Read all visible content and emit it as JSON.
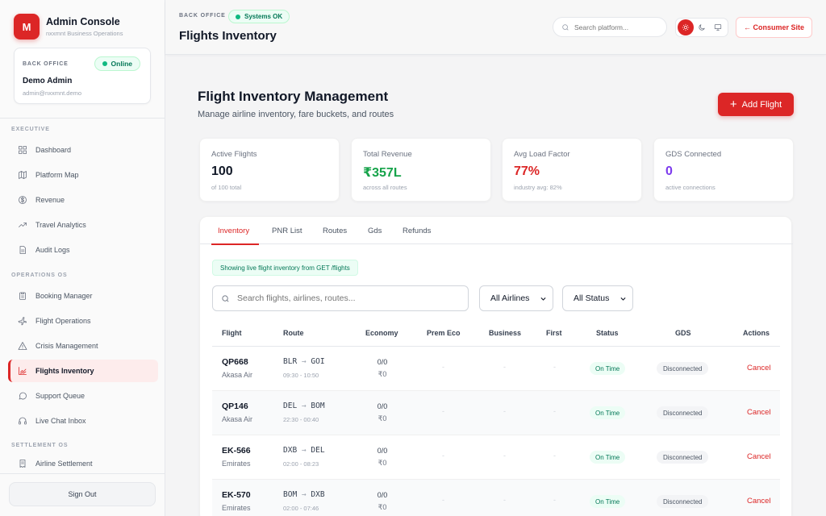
{
  "sidebar": {
    "logo_letter": "M",
    "title": "Admin Console",
    "subtitle": "nxxmnt Business Operations",
    "user_card": {
      "label": "BACK OFFICE",
      "status": "Online",
      "name": "Demo Admin",
      "email": "admin@nxxmnt.demo"
    },
    "sections": {
      "executive": "EXECUTIVE",
      "operations": "OPERATIONS OS",
      "settlement": "SETTLEMENT OS"
    },
    "items": [
      {
        "label": "Dashboard",
        "icon": "grid-icon"
      },
      {
        "label": "Platform Map",
        "icon": "map-icon"
      },
      {
        "label": "Revenue",
        "icon": "dollar-icon"
      },
      {
        "label": "Travel Analytics",
        "icon": "trend-icon"
      },
      {
        "label": "Audit Logs",
        "icon": "document-icon"
      },
      {
        "label": "Booking Manager",
        "icon": "clipboard-icon"
      },
      {
        "label": "Flight Operations",
        "icon": "plane-icon"
      },
      {
        "label": "Crisis Management",
        "icon": "alert-icon"
      },
      {
        "label": "Flights Inventory",
        "icon": "chart-icon"
      },
      {
        "label": "Support Queue",
        "icon": "chat-icon"
      },
      {
        "label": "Live Chat Inbox",
        "icon": "headset-icon"
      },
      {
        "label": "Airline Settlement",
        "icon": "receipt-icon"
      }
    ],
    "signout_label": "Sign Out"
  },
  "topbar": {
    "eyebrow": "BACK OFFICE",
    "status": "Systems OK",
    "title": "Flights Inventory",
    "search_placeholder": "Search platform...",
    "consumer_label": "← Consumer Site"
  },
  "main": {
    "title": "Flight Inventory Management",
    "subtitle": "Manage airline inventory, fare buckets, and routes",
    "add_label": "Add Flight",
    "stats": [
      {
        "label": "Active Flights",
        "value": "100",
        "sub": "of 100 total",
        "color": "#111827"
      },
      {
        "label": "Total Revenue",
        "value": "₹357L",
        "sub": "across all routes",
        "color": "#16a34a"
      },
      {
        "label": "Avg Load Factor",
        "value": "77%",
        "sub": "industry avg: 82%",
        "color": "#dc2626"
      },
      {
        "label": "GDS Connected",
        "value": "0",
        "sub": "active connections",
        "color": "#7c3aed"
      }
    ],
    "tabs": [
      "Inventory",
      "PNR List",
      "Routes",
      "Gds",
      "Refunds"
    ],
    "info": "Showing live flight inventory from GET /flights",
    "search_placeholder": "Search flights, airlines, routes...",
    "airline_filter": "All Airlines",
    "status_filter": "All Status",
    "columns": [
      "Flight",
      "Route",
      "Economy",
      "Prem Eco",
      "Business",
      "First",
      "Status",
      "GDS",
      "Actions"
    ],
    "rows": [
      {
        "flight": "QP668",
        "airline": "Akasa Air",
        "from": "BLR",
        "to": "GOI",
        "time": "09:30 - 10:50",
        "eco": "0/0",
        "eco_price": "₹0",
        "prem": "-",
        "biz": "-",
        "first": "-",
        "status": "On Time",
        "gds": "Disconnected",
        "action": "Cancel"
      },
      {
        "flight": "QP146",
        "airline": "Akasa Air",
        "from": "DEL",
        "to": "BOM",
        "time": "22:30 - 00:40",
        "eco": "0/0",
        "eco_price": "₹0",
        "prem": "-",
        "biz": "-",
        "first": "-",
        "status": "On Time",
        "gds": "Disconnected",
        "action": "Cancel"
      },
      {
        "flight": "EK-566",
        "airline": "Emirates",
        "from": "DXB",
        "to": "DEL",
        "time": "02:00 - 08:23",
        "eco": "0/0",
        "eco_price": "₹0",
        "prem": "-",
        "biz": "-",
        "first": "-",
        "status": "On Time",
        "gds": "Disconnected",
        "action": "Cancel"
      },
      {
        "flight": "EK-570",
        "airline": "Emirates",
        "from": "BOM",
        "to": "DXB",
        "time": "02:00 - 07:46",
        "eco": "0/0",
        "eco_price": "₹0",
        "prem": "-",
        "biz": "-",
        "first": "-",
        "status": "On Time",
        "gds": "Disconnected",
        "action": "Cancel"
      }
    ],
    "route_arrow": "→"
  }
}
